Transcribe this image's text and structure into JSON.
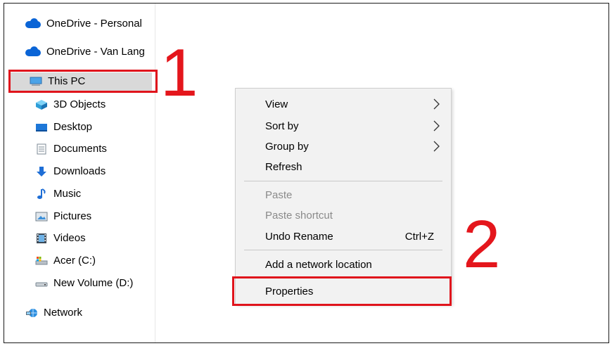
{
  "sidebar": {
    "items": [
      {
        "label": "OneDrive - Personal",
        "icon": "onedrive-cloud-icon"
      },
      {
        "label": "OneDrive - Van Lang",
        "icon": "onedrive-cloud-icon"
      },
      {
        "label": "This PC",
        "icon": "this-pc-icon",
        "selected": true
      },
      {
        "label": "3D Objects",
        "icon": "3d-objects-icon"
      },
      {
        "label": "Desktop",
        "icon": "desktop-icon"
      },
      {
        "label": "Documents",
        "icon": "documents-icon"
      },
      {
        "label": "Downloads",
        "icon": "downloads-icon"
      },
      {
        "label": "Music",
        "icon": "music-icon"
      },
      {
        "label": "Pictures",
        "icon": "pictures-icon"
      },
      {
        "label": "Videos",
        "icon": "videos-icon"
      },
      {
        "label": "Acer (C:)",
        "icon": "drive-c-icon"
      },
      {
        "label": "New Volume (D:)",
        "icon": "drive-d-icon"
      },
      {
        "label": "Network",
        "icon": "network-icon"
      }
    ]
  },
  "context_menu": {
    "items": [
      {
        "label": "View",
        "submenu": true
      },
      {
        "label": "Sort by",
        "submenu": true
      },
      {
        "label": "Group by",
        "submenu": true
      },
      {
        "label": "Refresh"
      },
      {
        "label": "Paste",
        "disabled": true
      },
      {
        "label": "Paste shortcut",
        "disabled": true
      },
      {
        "label": "Undo Rename",
        "shortcut": "Ctrl+Z"
      },
      {
        "label": "Add a network location"
      },
      {
        "label": "Properties"
      }
    ]
  },
  "annotations": {
    "step1": "1",
    "step2": "2",
    "color": "#e0141c"
  },
  "colors": {
    "selection": "#d9d9d9",
    "menu_bg": "#f2f2f2",
    "onedrive_blue": "#0a64d6",
    "disabled_text": "#8a8a8a"
  }
}
